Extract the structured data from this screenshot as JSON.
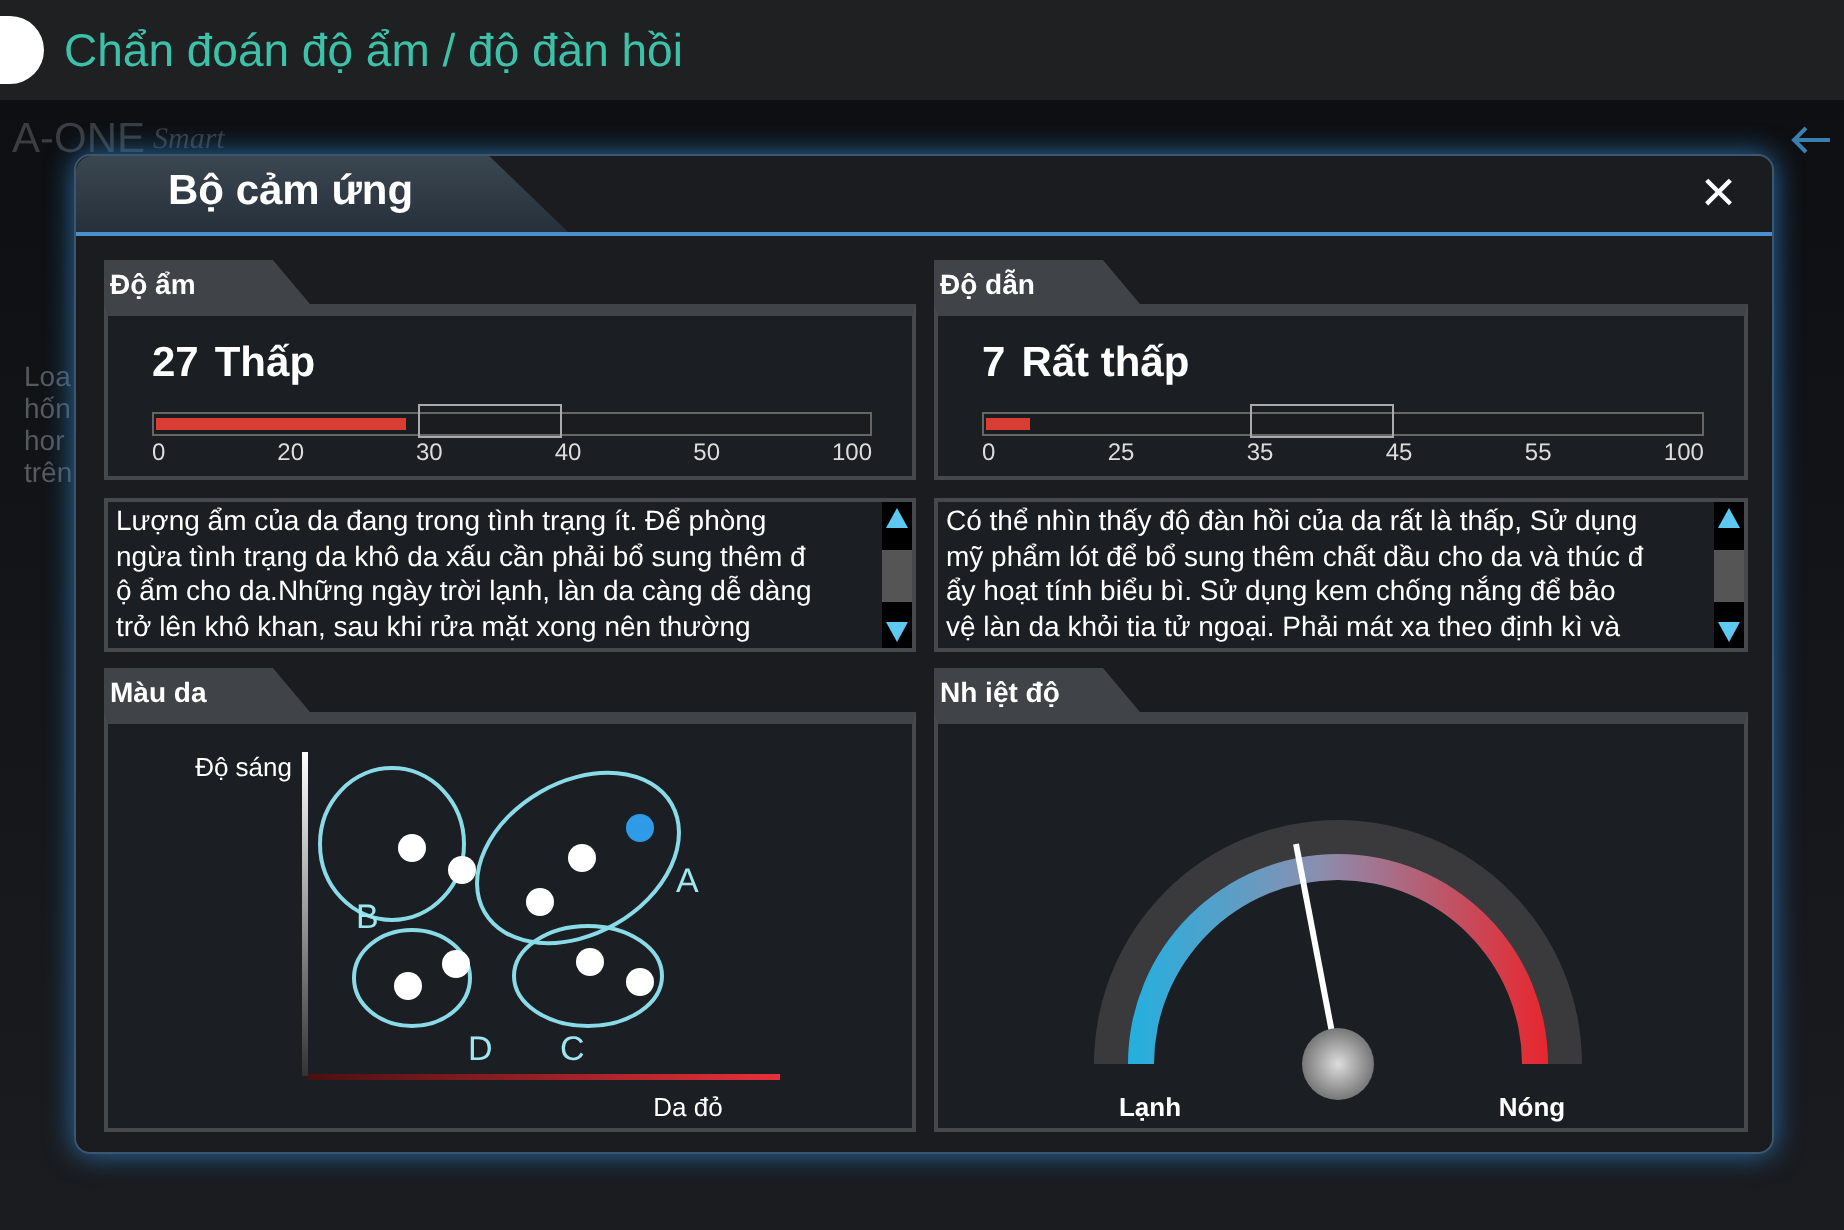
{
  "title_bar": {
    "title": "Chẩn đoán độ ẩm / độ đàn hồi"
  },
  "background": {
    "logo": "A-ONE",
    "logo_suffix": "Smart",
    "side_text": [
      "Loa",
      "hốn",
      "hor",
      "trên"
    ]
  },
  "dialog": {
    "title": "Bộ cảm ứng",
    "close": "×",
    "meters": [
      {
        "label": "Độ ẩm",
        "value": "27",
        "rating": "Thấp",
        "level": 0.35,
        "ticks": [
          "0",
          "20",
          "30",
          "40",
          "50",
          "100"
        ],
        "description": [
          "Lượng ẩm của da đang trong tình trạng ít. Để phòng",
          "ngừa tình trạng da khô da xấu cần phải bổ sung thêm đ",
          "ộ ẩm cho da.Những ngày trời lạnh, làn da càng dễ dàng",
          "trở lên khô khan, sau khi rửa mặt xong nên thường"
        ]
      },
      {
        "label": "Độ dẫn",
        "value": "7",
        "rating": "Rất thấp",
        "level": 0.06,
        "ticks": [
          "0",
          "25",
          "35",
          "45",
          "55",
          "100"
        ],
        "description": [
          "Có thể nhìn thấy độ đàn hồi của da rất là thấp, Sử dụng",
          "mỹ phẩm lót để bổ sung thêm chất dầu cho da và thúc đ",
          "ẩy hoạt tính biểu bì. Sử dụng kem chống nắng để bảo",
          "vệ làn da khỏi tia tử ngoại. Phải mát xa theo định kì và"
        ]
      }
    ],
    "skin_color": {
      "label": "Màu da",
      "y_axis": "Độ sáng",
      "x_axis": "Da đỏ",
      "groups": [
        "A",
        "B",
        "C",
        "D"
      ]
    },
    "temperature": {
      "label": "Nh iệt độ",
      "level": 0.44,
      "low": "Lạnh",
      "high": "Nóng"
    }
  }
}
